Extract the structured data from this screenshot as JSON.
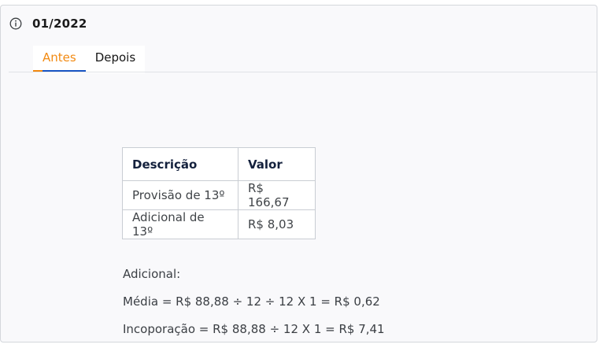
{
  "header": {
    "icon": "info-icon",
    "period": "01/2022"
  },
  "tabs": [
    {
      "label": "Antes",
      "active": true
    },
    {
      "label": "Depois",
      "active": false
    }
  ],
  "table": {
    "headers": [
      "Descrição",
      "Valor"
    ],
    "rows": [
      [
        "Provisão de 13º",
        "R$ 166,67"
      ],
      [
        "Adicional de 13º",
        "R$ 8,03"
      ]
    ]
  },
  "notes": {
    "title": "Adicional:",
    "media": "Média = R$ 88,88 ÷ 12 ÷ 12 X 1 = R$ 0,62",
    "incorporacao": "Incoporação = R$ 88,88 ÷ 12 X 1 = R$ 7,41"
  },
  "colors": {
    "accent_orange": "#f28a12",
    "accent_blue": "#1a56c4"
  }
}
